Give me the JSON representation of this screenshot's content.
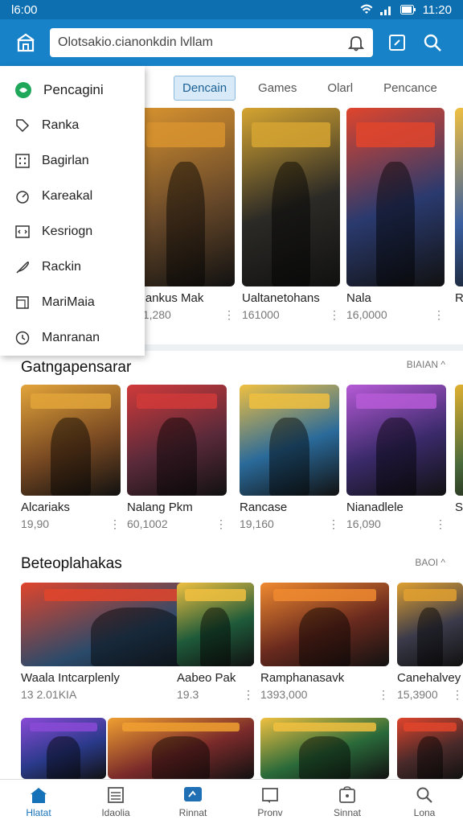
{
  "status_bar": {
    "time_left": "l6:00",
    "time_right": "11:20"
  },
  "search": {
    "value": "Olotsakio.cianonkdin lvllam"
  },
  "tabs": [
    {
      "label": "Dencain"
    },
    {
      "label": "Games"
    },
    {
      "label": "Olarl"
    },
    {
      "label": "Pencance"
    }
  ],
  "drawer": {
    "items": [
      {
        "label": "Pencagini",
        "icon": "app-logo-icon"
      },
      {
        "label": "Ranka",
        "icon": "tag-icon"
      },
      {
        "label": "Bagirlan",
        "icon": "grid-icon"
      },
      {
        "label": "Kareakal",
        "icon": "gauge-icon"
      },
      {
        "label": "Kesriogn",
        "icon": "code-icon"
      },
      {
        "label": "Rackin",
        "icon": "feather-icon"
      },
      {
        "label": "MariMaia",
        "icon": "square-icon"
      },
      {
        "label": "Manranan",
        "icon": "clock-icon"
      }
    ]
  },
  "row1": [
    {
      "title": "Rankus Mak",
      "meta": "21,280",
      "bg": "#6a4a2a",
      "accent": "#d8932f"
    },
    {
      "title": "Ualtanetohans",
      "meta": "161000",
      "bg": "#2b2a26",
      "accent": "#d6a531"
    },
    {
      "title": "Nala",
      "meta": "16,0000",
      "bg": "#2a3a6e",
      "accent": "#e0452c"
    },
    {
      "title": "R",
      "meta": "",
      "bg": "#3a5fa0",
      "accent": "#f0c040"
    }
  ],
  "section2": {
    "title": "Gatngapensarar",
    "more": "BIAIAN ^",
    "items": [
      {
        "title": "Alcariaks",
        "meta": "19,90",
        "bg": "#7a4a22",
        "accent": "#e2a43a"
      },
      {
        "title": "Nalang Pkm",
        "meta": "60,1002",
        "bg": "#5a2a3a",
        "accent": "#d03a3a"
      },
      {
        "title": "Rancase",
        "meta": "19,160",
        "bg": "#2a6a9a",
        "accent": "#f0c040"
      },
      {
        "title": "Nianadlele",
        "meta": "16,090",
        "bg": "#3a2a6a",
        "accent": "#b65ad6"
      },
      {
        "title": "S",
        "meta": "",
        "bg": "#4a6a3a",
        "accent": "#e0b030"
      }
    ]
  },
  "section3": {
    "title": "Beteoplahakas",
    "more": "BAOI ^",
    "items": [
      {
        "title": "Waala Intcarplenly",
        "meta": "13 2.01KIA",
        "bg": "#2a4a6a",
        "accent": "#e0452c"
      },
      {
        "title": "Aabeo Pak",
        "meta": "19.3",
        "bg": "#1e5a3a",
        "accent": "#f0c040"
      },
      {
        "title": "Ramphanasavk",
        "meta": "1393,000",
        "bg": "#6a2a1e",
        "accent": "#f08a30"
      },
      {
        "title": "Canehalvey",
        "meta": "15,3900",
        "bg": "#3a3a4a",
        "accent": "#e0a030"
      }
    ]
  },
  "row4": [
    {
      "bg": "#2a3a8a",
      "accent": "#8a4ad6"
    },
    {
      "bg": "#7a2a2a",
      "accent": "#f0a030"
    },
    {
      "bg": "#2a6a3a",
      "accent": "#f0c040"
    },
    {
      "bg": "#4a2a2a",
      "accent": "#e0452c"
    }
  ],
  "bottom_nav": [
    {
      "label": "Hlatat",
      "icon": "home-icon"
    },
    {
      "label": "Idaolia",
      "icon": "list-icon"
    },
    {
      "label": "Rinnat",
      "icon": "chat-icon"
    },
    {
      "label": "Pronv",
      "icon": "folder-icon"
    },
    {
      "label": "Sinnat",
      "icon": "store-icon"
    },
    {
      "label": "Lona",
      "icon": "search-icon"
    }
  ]
}
